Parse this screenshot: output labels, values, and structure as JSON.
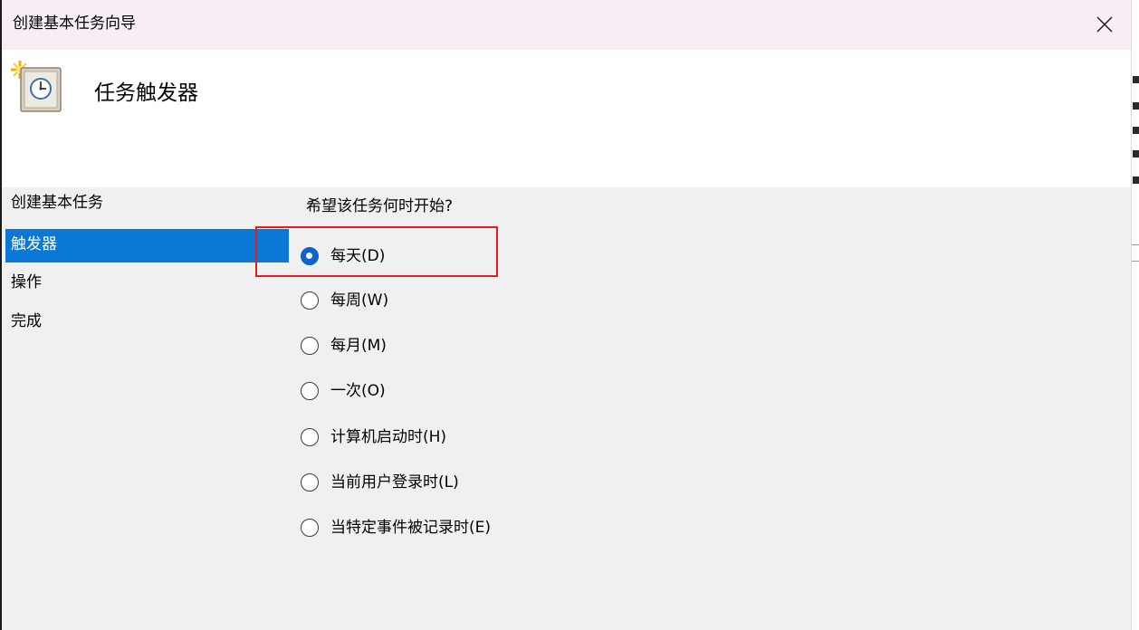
{
  "window": {
    "title": "创建基本任务向导",
    "close_icon": "close-icon"
  },
  "header": {
    "icon": "task-scheduler-clock-icon",
    "title": "任务触发器"
  },
  "sidebar": {
    "items": [
      {
        "label": "创建基本任务",
        "active": false
      },
      {
        "label": "触发器",
        "active": true
      },
      {
        "label": "操作",
        "active": false
      },
      {
        "label": "完成",
        "active": false
      }
    ]
  },
  "main": {
    "question": "希望该任务何时开始?",
    "options": [
      {
        "label": "每天(D)",
        "checked": true
      },
      {
        "label": "每周(W)",
        "checked": false
      },
      {
        "label": "每月(M)",
        "checked": false
      },
      {
        "label": "一次(O)",
        "checked": false
      },
      {
        "label": "计算机启动时(H)",
        "checked": false
      },
      {
        "label": "当前用户登录时(L)",
        "checked": false
      },
      {
        "label": "当特定事件被记录时(E)",
        "checked": false
      }
    ]
  },
  "colors": {
    "titlebar_bg": "#f7eef5",
    "selection_blue": "#0a78d7",
    "radio_checked": "#0a64c9",
    "annotation_red": "#e02020"
  }
}
